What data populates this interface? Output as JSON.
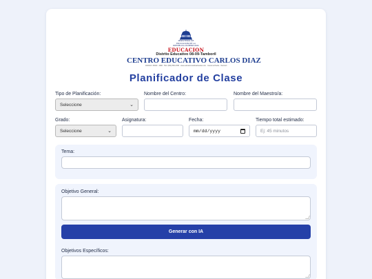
{
  "logo": {
    "seal_line1": "MINISTERIO DE",
    "seal_line2": "EDUCACION DE LA",
    "seal_line3": "REPUBLICA DOMINICANA",
    "edu": "EDUCACION",
    "district": "Distrito Educativo 08-09-Tamboril",
    "center_name": "CENTRO EDUCATIVO CARLOS DIAZ",
    "contact": "CODIGO: 05000 · 4698 · TEL: (809) 580-3788 · www.educacionsoldcarlosdiaz.com · Canca la Piedra - Tamboril"
  },
  "page_title": "Planificador de Clase",
  "form": {
    "tipo_label": "Tipo de Planificación:",
    "tipo_value": "Seleccione",
    "centro_label": "Nombre del Centro:",
    "centro_value": "",
    "maestro_label": "Nombre del Maestro/a:",
    "maestro_value": "",
    "grado_label": "Grado:",
    "grado_value": "Seleccione",
    "asignatura_label": "Asignatura:",
    "asignatura_value": "",
    "fecha_label": "Fecha:",
    "fecha_value": "mm/dd/yyyy",
    "tiempo_label": "Tiempo total estimado:",
    "tiempo_placeholder": "Ej: 45 minutos",
    "tema_label": "Tema:",
    "objetivo_general_label": "Objetivo General:",
    "generar_button": "Generar con IA",
    "objetivos_especificos_label": "Objetivos Específicos:"
  },
  "colors": {
    "accent": "#2540a8",
    "title": "#2440a0",
    "brand_red": "#c8141e",
    "section_bg": "#f0f4fd"
  },
  "icons": {
    "select": "chevron-down-icon",
    "date": "calendar-icon"
  }
}
